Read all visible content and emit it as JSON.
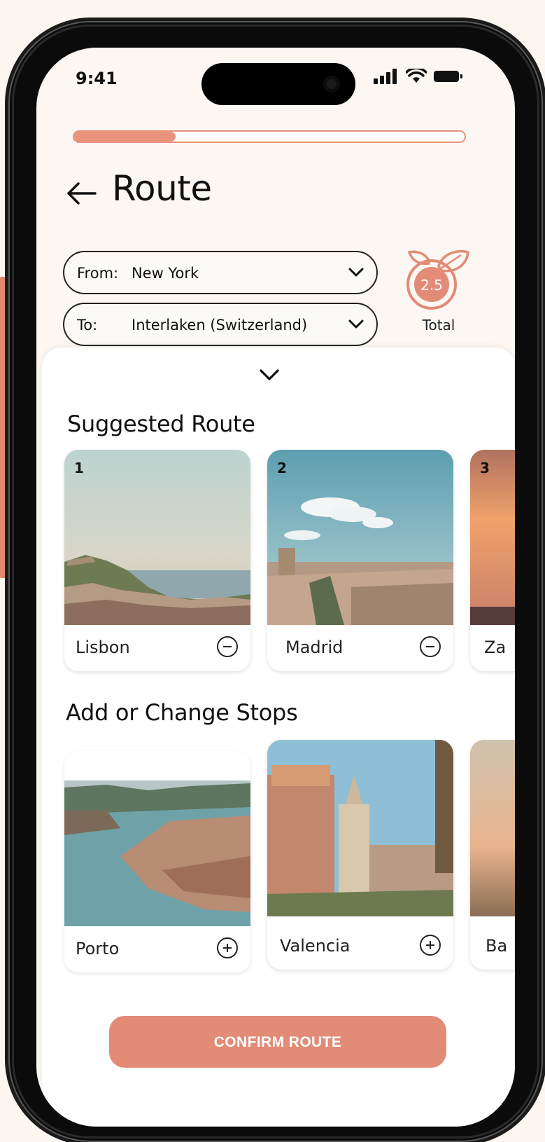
{
  "status_bar": {
    "time": "9:41"
  },
  "progress": {
    "fraction": 0.26
  },
  "header": {
    "title": "Route"
  },
  "from": {
    "label": "From:",
    "value": "New York"
  },
  "to": {
    "label": "To:",
    "value": "Interlaken (Switzerland)"
  },
  "footprint": {
    "value": "2.5",
    "label": "Total"
  },
  "suggested": {
    "title": "Suggested Route",
    "items": [
      {
        "number": "1",
        "name": "Lisbon"
      },
      {
        "number": "2",
        "name": "Madrid"
      },
      {
        "number": "3",
        "name": "Za"
      }
    ]
  },
  "stops": {
    "title": "Add or Change Stops",
    "items": [
      {
        "name": "Porto"
      },
      {
        "name": "Valencia"
      },
      {
        "name": "Ba"
      }
    ]
  },
  "confirm": {
    "label": "CONFIRM ROUTE"
  },
  "colors": {
    "accent": "#e28b76",
    "background": "#fcf7f3"
  }
}
